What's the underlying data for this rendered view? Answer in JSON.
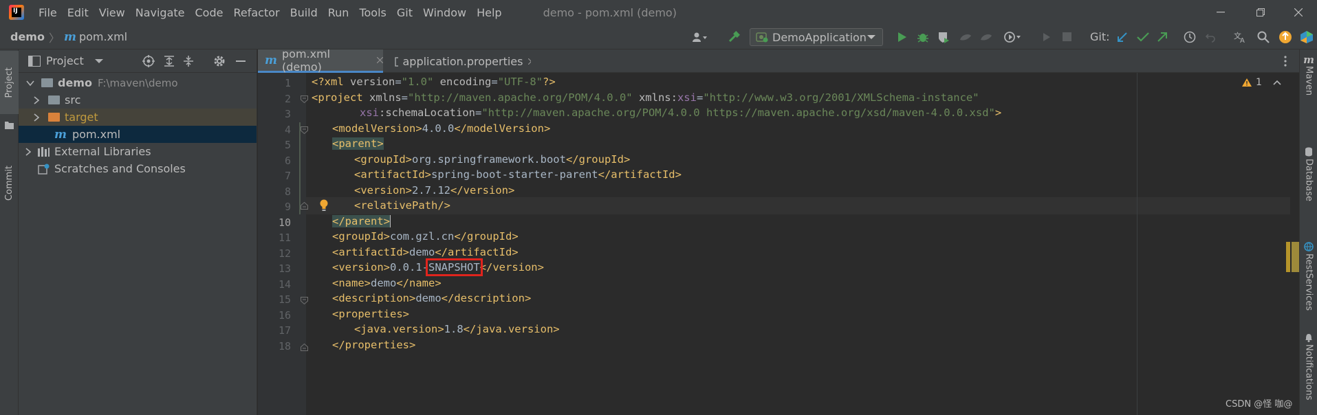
{
  "menu": [
    "File",
    "Edit",
    "View",
    "Navigate",
    "Code",
    "Refactor",
    "Build",
    "Run",
    "Tools",
    "Git",
    "Window",
    "Help"
  ],
  "window_title": "demo - pom.xml (demo)",
  "breadcrumb": {
    "project": "demo",
    "file": "pom.xml"
  },
  "run_config": "DemoApplication",
  "git_label": "Git:",
  "left_tabs": {
    "project": "Project",
    "commit": "Commit"
  },
  "project_panel": {
    "title": "Project",
    "tree": {
      "demo": "demo",
      "demo_path": "F:\\maven\\demo",
      "src": "src",
      "target": "target",
      "pom": "pom.xml",
      "external": "External Libraries",
      "scratches": "Scratches and Consoles"
    }
  },
  "tabs": [
    {
      "label": "pom.xml (demo)",
      "active": true
    },
    {
      "label": "application.properties",
      "active": false
    }
  ],
  "inspection": {
    "count": "1"
  },
  "line_numbers": [
    "1",
    "2",
    "3",
    "4",
    "5",
    "6",
    "7",
    "8",
    "9",
    "10",
    "11",
    "12",
    "13",
    "14",
    "15",
    "16",
    "17",
    "18"
  ],
  "code": {
    "l1": {
      "decl_start": "<?xml ",
      "version_attr": "version",
      "eq": "=",
      "version_val": "\"1.0\"",
      "encoding_attr": " encoding",
      "encoding_val": "\"UTF-8\"",
      "decl_end": "?>"
    },
    "l2": {
      "tag_open": "<project ",
      "xmlns_attr": "xmlns",
      "eq": "=",
      "xmlns_val": "\"http://maven.apache.org/POM/4.0.0\"",
      "xsi_attr": " xmlns:",
      "xsi_prefix": "xsi",
      "xsi_val": "\"http://www.w3.org/2001/XMLSchema-instance\""
    },
    "l3": {
      "prefix": "xsi",
      "attr": ":schemaLocation",
      "eq": "=",
      "val": "\"http://maven.apache.org/POM/4.0.0 https://maven.apache.org/xsd/maven-4.0.0.xsd\"",
      "close": ">"
    },
    "l4": {
      "open": "<modelVersion>",
      "text": "4.0.0",
      "close": "</modelVersion>"
    },
    "l5": {
      "open": "<parent>"
    },
    "l6": {
      "open": "<groupId>",
      "text": "org.springframework.boot",
      "close": "</groupId>"
    },
    "l7": {
      "open": "<artifactId>",
      "text": "spring-boot-starter-parent",
      "close": "</artifactId>"
    },
    "l8": {
      "open": "<version>",
      "text": "2.7.12",
      "close": "</version>"
    },
    "l9": {
      "open": "<relativePath/>"
    },
    "l10": {
      "close": "</parent>"
    },
    "l11": {
      "open": "<groupId>",
      "text": "com.gzl.cn",
      "close": "</groupId>"
    },
    "l12": {
      "open": "<artifactId>",
      "text": "demo",
      "close": "</artifactId>"
    },
    "l13": {
      "open": "<version>",
      "text_a": "0.0.1-",
      "text_b": "SNAPSHOT",
      "close": "</version>"
    },
    "l14": {
      "open": "<name>",
      "text": "demo",
      "close": "</name>"
    },
    "l15": {
      "open": "<description>",
      "text": "demo",
      "close": "</description>"
    },
    "l16": {
      "open": "<properties>"
    },
    "l17": {
      "open": "<java.version>",
      "text": "1.8",
      "close": "</java.version>"
    },
    "l18": {
      "close": "</properties>"
    }
  },
  "right_tabs": {
    "maven": "Maven",
    "database": "Database",
    "rest": "RestServices",
    "notifications": "Notifications"
  },
  "watermark": "CSDN @怪 咖@",
  "colors": {
    "tag": "#e8bf6a",
    "attr": "#bababa",
    "value": "#6a8759",
    "namespace": "#9876aa",
    "text": "#a9b7c6",
    "highlight_box": "#e0241d",
    "accent": "#4a9fd8"
  },
  "icons": [
    "app-logo",
    "person-icon",
    "hammer-icon",
    "run-icon",
    "debug-icon",
    "coverage-icon",
    "profile-icon",
    "attach-icon",
    "stop-icon",
    "git-update-icon",
    "git-commit-icon",
    "git-push-icon",
    "history-icon",
    "rollback-icon",
    "translate-icon",
    "search-icon",
    "update-icon",
    "toolbox-icon",
    "target-icon",
    "expand-icon",
    "collapse-icon",
    "gear-icon",
    "minimize-icon",
    "warning-icon",
    "bulb-icon",
    "more-icon"
  ]
}
